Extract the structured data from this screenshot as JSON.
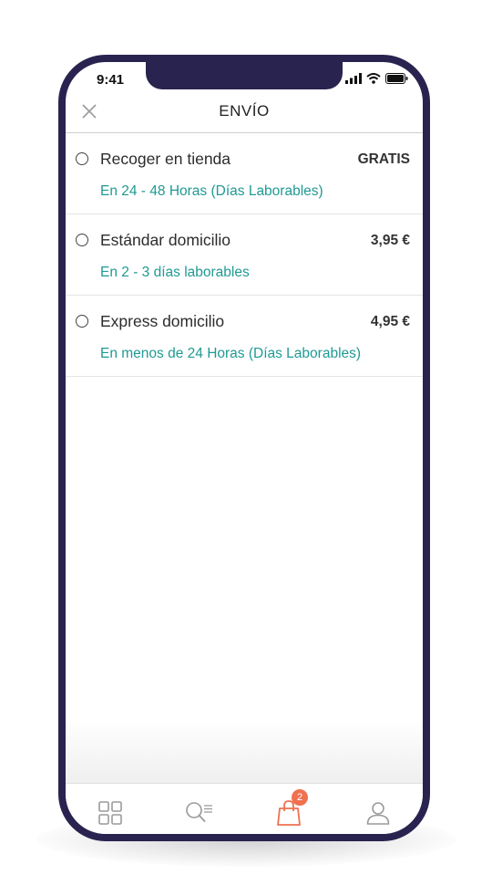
{
  "status_bar": {
    "time": "9:41"
  },
  "header": {
    "title": "ENVÍO"
  },
  "shipping_options": [
    {
      "title": "Recoger en tienda",
      "price": "GRATIS",
      "subtitle": "En 24 - 48 Horas (Días Laborables)"
    },
    {
      "title": "Estándar domicilio",
      "price": "3,95 €",
      "subtitle": "En 2 - 3 días laborables"
    },
    {
      "title": "Express domicilio",
      "price": "4,95 €",
      "subtitle": "En menos de 24 Horas (Días Laborables)"
    }
  ],
  "tabbar": {
    "items": [
      {
        "icon": "grid-icon"
      },
      {
        "icon": "search-list-icon"
      },
      {
        "icon": "shopping-bag-icon",
        "badge": "2"
      },
      {
        "icon": "user-icon"
      }
    ]
  },
  "colors": {
    "frame": "#29234f",
    "accent_teal": "#1f9a93",
    "accent_orange": "#f0704f",
    "icon_gray": "#9a9a9a"
  }
}
